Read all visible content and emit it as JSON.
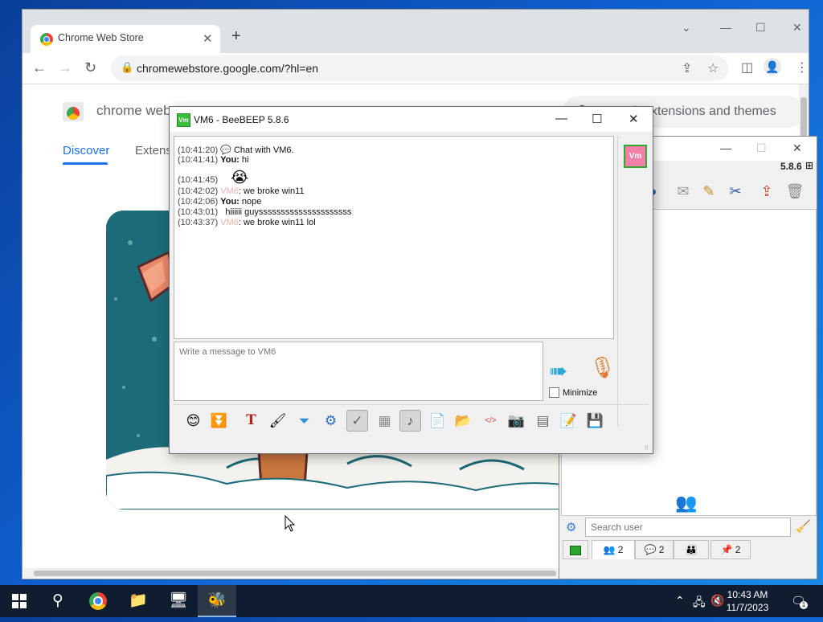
{
  "chrome": {
    "tab_title": "Chrome Web Store",
    "tab_close": "✕",
    "new_tab": "+",
    "url": "chromewebstore.google.com/?hl=en",
    "page": {
      "brand": "chrome web store",
      "search_placeholder": "Search extensions and themes",
      "nav_tabs": [
        "Discover",
        "Extensions"
      ]
    }
  },
  "beebeep_main": {
    "version_label": "5.8.6",
    "search_placeholder": "Search user",
    "bottom_tabs": [
      {
        "count": "2"
      },
      {
        "count": "2"
      },
      {
        "count": ""
      },
      {
        "count": "2"
      }
    ]
  },
  "chat": {
    "window_title": "VM6 - BeeBEEP 5.8.6",
    "avatar_badge": "Vm",
    "messages": [
      {
        "time": "(10:41:20)",
        "sender": "",
        "text": "Chat with VM6.",
        "kind": "system"
      },
      {
        "time": "(10:41:41)",
        "sender": "You:",
        "text": "hi",
        "kind": "you"
      },
      {
        "time": "(10:41:45)",
        "sender": "",
        "text": "",
        "kind": "emoji"
      },
      {
        "time": "(10:42:02)",
        "sender": "VM6",
        "text": ": we broke win11",
        "kind": "vm"
      },
      {
        "time": "(10:42:06)",
        "sender": "You:",
        "text": "nope",
        "kind": "you"
      },
      {
        "time": "(10:43:01)",
        "sender": "",
        "text": "hiiiiii guysssssssssssssssssssss",
        "kind": "plain"
      },
      {
        "time": "(10:43:37)",
        "sender": "VM6",
        "text": ": we broke win11 lol",
        "kind": "vm"
      }
    ],
    "input_placeholder": "Write a message to VM6",
    "minimize_label": "Minimize",
    "toolbar_icons": [
      "smiley-icon",
      "green-arrow-icon",
      "font-icon",
      "color-icon",
      "filter-icon",
      "settings-icon",
      "spellcheck-icon",
      "word-complete-icon",
      "sound-icon",
      "send-file-icon",
      "send-folder-icon",
      "html-icon",
      "screenshot-icon",
      "clear-icon",
      "save-icon",
      "save-as-icon"
    ]
  },
  "taskbar": {
    "time": "10:43 AM",
    "date": "11/7/2023",
    "notification_count": "1"
  },
  "colors": {
    "chrome_accent": "#1a73e8",
    "taskbar": "#101d30",
    "beebeep_green": "#3bbf3b",
    "vm_name": "#f3b0b0"
  }
}
